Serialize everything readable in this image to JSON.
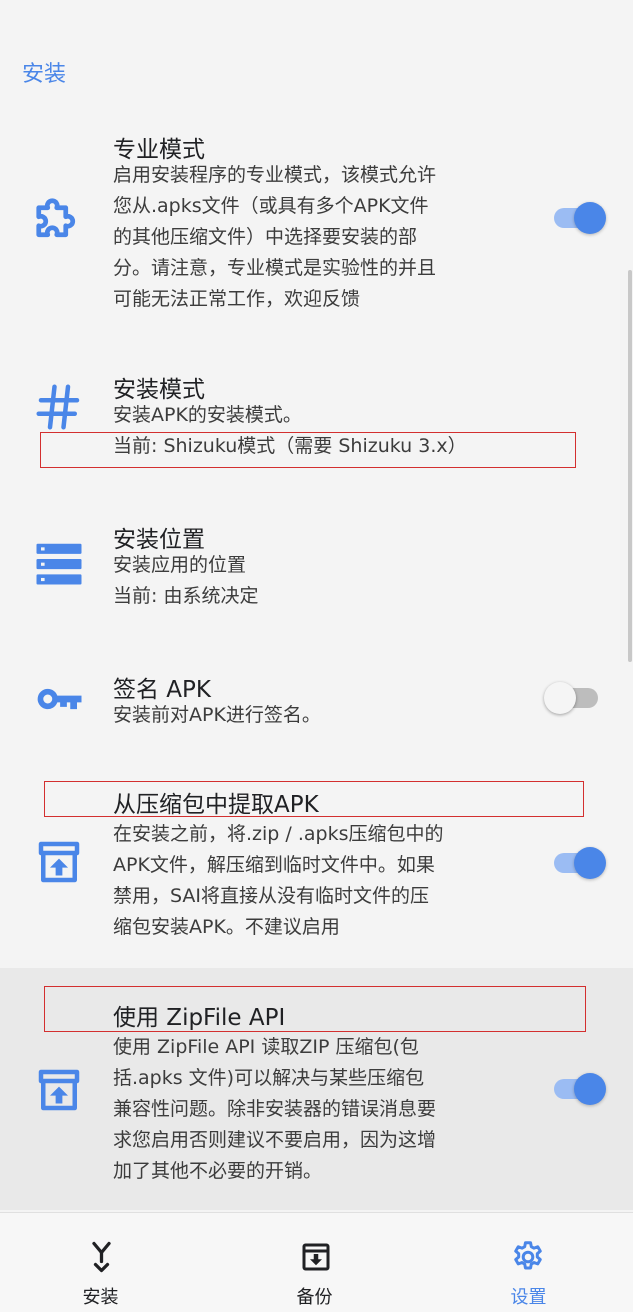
{
  "section_header": "安装",
  "prefs": {
    "pro_mode": {
      "title": "专业模式",
      "summary": [
        "启用安装程序的专业模式，该模式允许",
        "您从.apks文件（或具有多个APK文件",
        "的其他压缩文件）中选择要安装的部",
        "分。请注意，专业模式是实验性的并且",
        "可能无法正常工作，欢迎反馈"
      ],
      "icon": "puzzle-icon",
      "checked": true
    },
    "install_mode": {
      "title": "安装模式",
      "summary": [
        "安装APK的安装模式。",
        "当前: Shizuku模式（需要 Shizuku 3.x）"
      ],
      "icon": "hash-icon"
    },
    "install_location": {
      "title": "安装位置",
      "summary": [
        "安装应用的位置",
        "当前: 由系统决定"
      ],
      "icon": "storage-icon"
    },
    "sign_apk": {
      "title": "签名 APK",
      "summary": [
        "安装前对APK进行签名。"
      ],
      "icon": "key-icon",
      "checked": false
    },
    "extract_archive": {
      "title": "从压缩包中提取APK",
      "summary": [
        "在安装之前，将.zip / .apks压缩包中的",
        "APK文件，解压缩到临时文件中。如果",
        "禁用，SAI将直接从没有临时文件的压",
        "缩包安装APK。不建议启用"
      ],
      "icon": "archive-upload-icon",
      "checked": true
    },
    "zipfile_api": {
      "title": "使用 ZipFile API",
      "summary": [
        "使用 ZipFile API 读取ZIP 压缩包(包",
        "括.apks 文件)可以解决与某些压缩包",
        "兼容性问题。除非安装器的错误消息要",
        "求您启用否则建议不要启用，因为这增",
        "加了其他不必要的开销。"
      ],
      "icon": "archive-upload-icon",
      "checked": true
    }
  },
  "bottom_nav": [
    {
      "label": "安装",
      "icon": "installer-icon",
      "active": false
    },
    {
      "label": "备份",
      "icon": "backup-icon",
      "active": false
    },
    {
      "label": "设置",
      "icon": "settings-gear-icon",
      "active": true
    }
  ],
  "colors": {
    "accent": "#4a86e8",
    "annotation_red": "#d32f2f"
  }
}
